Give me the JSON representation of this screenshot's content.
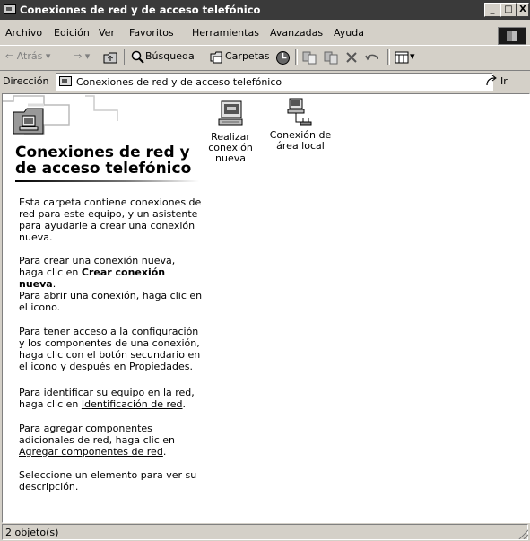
{
  "window": {
    "title": "Conexiones de red y de acceso telefónico",
    "min_label": "_",
    "max_label": "□",
    "close_label": "X"
  },
  "menubar": {
    "items": [
      {
        "label": "Archivo"
      },
      {
        "label": "Edición"
      },
      {
        "label": "Ver"
      },
      {
        "label": "Favoritos"
      },
      {
        "label": "Herramientas"
      },
      {
        "label": "Avanzadas"
      },
      {
        "label": "Ayuda"
      }
    ]
  },
  "toolbar": {
    "back": "⇐ Atrás ▾",
    "forward": "⇒ ▾",
    "search": "Búsqueda",
    "folders": "Carpetas",
    "views_arrow": "▾"
  },
  "address": {
    "label": "Dirección",
    "value": "Conexiones de red y de acceso telefónico",
    "go": "Ir"
  },
  "left_pane": {
    "title": "Conexiones de red y de acceso telefónico",
    "p1": "Esta carpeta contiene conexiones de red para este equipo, y un asistente para ayudarle a crear una conexión nueva.",
    "p2_prefix": "Para crear una conexión nueva, haga clic en ",
    "p2_bold": "Crear conexión nueva",
    "p2_suffix": ".",
    "p3": "Para abrir una conexión, haga clic en el icono.",
    "p4": "Para tener acceso a la configuración y los componentes de una conexión, haga clic con el botón secundario en el icono y después en Propiedades.",
    "p5_prefix": "Para identificar su equipo en la red, haga clic en ",
    "p5_link": "Identificación de red",
    "p5_suffix": ".",
    "p6_prefix": "Para agregar componentes adicionales de red, haga clic en ",
    "p6_link": "Agregar componentes de red",
    "p6_suffix": ".",
    "p7": "Seleccione un elemento para ver su descripción."
  },
  "items": [
    {
      "label_line1": "Realizar",
      "label_line2": "conexión",
      "label_line3": "nueva"
    },
    {
      "label_line1": "Conexión de",
      "label_line2": "área local"
    }
  ],
  "status": {
    "text": "2 objeto(s)"
  }
}
